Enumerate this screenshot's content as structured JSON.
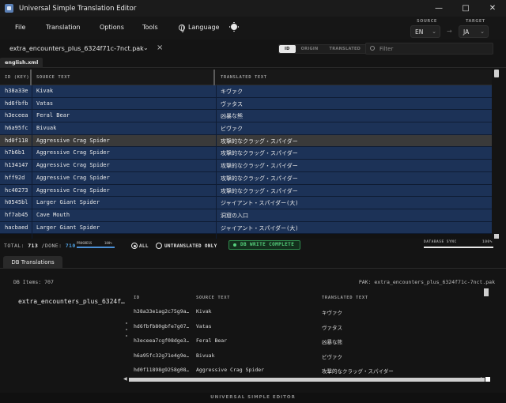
{
  "window": {
    "title": "Universal Simple Translation Editor"
  },
  "menu": {
    "file": "File",
    "translation": "Translation",
    "options": "Options",
    "tools": "Tools",
    "language": "Language"
  },
  "lang": {
    "source_cap": "SOURCE",
    "target_cap": "TARGET",
    "source": "EN",
    "target": "JA"
  },
  "file": {
    "name": "extra_encounters_plus_6324f71c-7nct.pak"
  },
  "view_mode": {
    "id": "ID",
    "origin": "ORIGIN",
    "translated": "TRANSLATED",
    "selected": "ID"
  },
  "filter": {
    "placeholder": "Filter"
  },
  "tab": {
    "name": "english.xml"
  },
  "grid": {
    "headers": {
      "id": "ID (KEY)",
      "source": "SOURCE TEXT",
      "translated": "TRANSLATED TEXT"
    },
    "rows": [
      {
        "id": "h38a33e",
        "src": "Kivak",
        "tr": "キヴァク"
      },
      {
        "id": "hd6fbfb",
        "src": "Vatas",
        "tr": "ヴァタス"
      },
      {
        "id": "h3eceea",
        "src": "Feral Bear",
        "tr": "凶暴な熊"
      },
      {
        "id": "h6a95fc",
        "src": "Bivuak",
        "tr": "ビヴァク"
      },
      {
        "id": "hd0f118",
        "src": "Aggressive Crag Spider",
        "tr": "攻撃的なクラッグ・スパイダー"
      },
      {
        "id": "h7b6b1",
        "src": "Aggressive Crag Spider",
        "tr": "攻撃的なクラッグ・スパイダー"
      },
      {
        "id": "h134147",
        "src": "Aggressive Crag Spider",
        "tr": "攻撃的なクラッグ・スパイダー"
      },
      {
        "id": "hff92d",
        "src": "Aggressive Crag Spider",
        "tr": "攻撃的なクラッグ・スパイダー"
      },
      {
        "id": "hc40273",
        "src": "Aggressive Crag Spider",
        "tr": "攻撃的なクラッグ・スパイダー"
      },
      {
        "id": "h0545bl",
        "src": "Larger Giant Spider",
        "tr": "ジャイアント・スパイダー(大)"
      },
      {
        "id": "hf7ab45",
        "src": "Cave Mouth",
        "tr": "洞窟の入口"
      },
      {
        "id": "hacbaed",
        "src": "Larger Giant Spider",
        "tr": "ジャイアント・スパイダー(大)"
      }
    ]
  },
  "status": {
    "total_label": "TOTAL:",
    "total": "713",
    "done_label": "/DONE:",
    "done": "710",
    "progress_label": "PROGRESS",
    "progress_value": "100%",
    "progress_fraction": 0.996,
    "all_label": "ALL",
    "untranslated_label": "UNTRANSLATED ONLY",
    "filter_selected": "ALL",
    "db_status": "DB WRITE COMPLETE",
    "sync_label": "DATABASE SYNC",
    "sync_value": "100%"
  },
  "bottom_tab": {
    "label": "DB Translations"
  },
  "db": {
    "items_label": "DB Items: 707",
    "pak_label": "PAK: extra_encounters_plus_6324f71c-7nct.pak",
    "side_item": "extra_encounters_plus_6324f…",
    "headers": {
      "id": "ID",
      "source": "SOURCE TEXT",
      "translated": "TRANSLATED TEXT"
    },
    "rows": [
      {
        "id": "h38a33e1ag2c75g9a…",
        "src": "Kivak",
        "tr": "キヴァク"
      },
      {
        "id": "hd6fbfb80gbfe7g07…",
        "src": "Vatas",
        "tr": "ヴァタス"
      },
      {
        "id": "h3eceea7cgf08dge3…",
        "src": "Feral Bear",
        "tr": "凶暴な熊"
      },
      {
        "id": "h6a95fc32g71e4g9e…",
        "src": "Bivuak",
        "tr": "ビヴァク"
      },
      {
        "id": "hd0f11898g9258g08…",
        "src": "Aggressive Crag Spider",
        "tr": "攻撃的なクラッグ・スパイダー"
      }
    ]
  },
  "footer": {
    "text": "UNIVERSAL SIMPLE EDITOR"
  }
}
